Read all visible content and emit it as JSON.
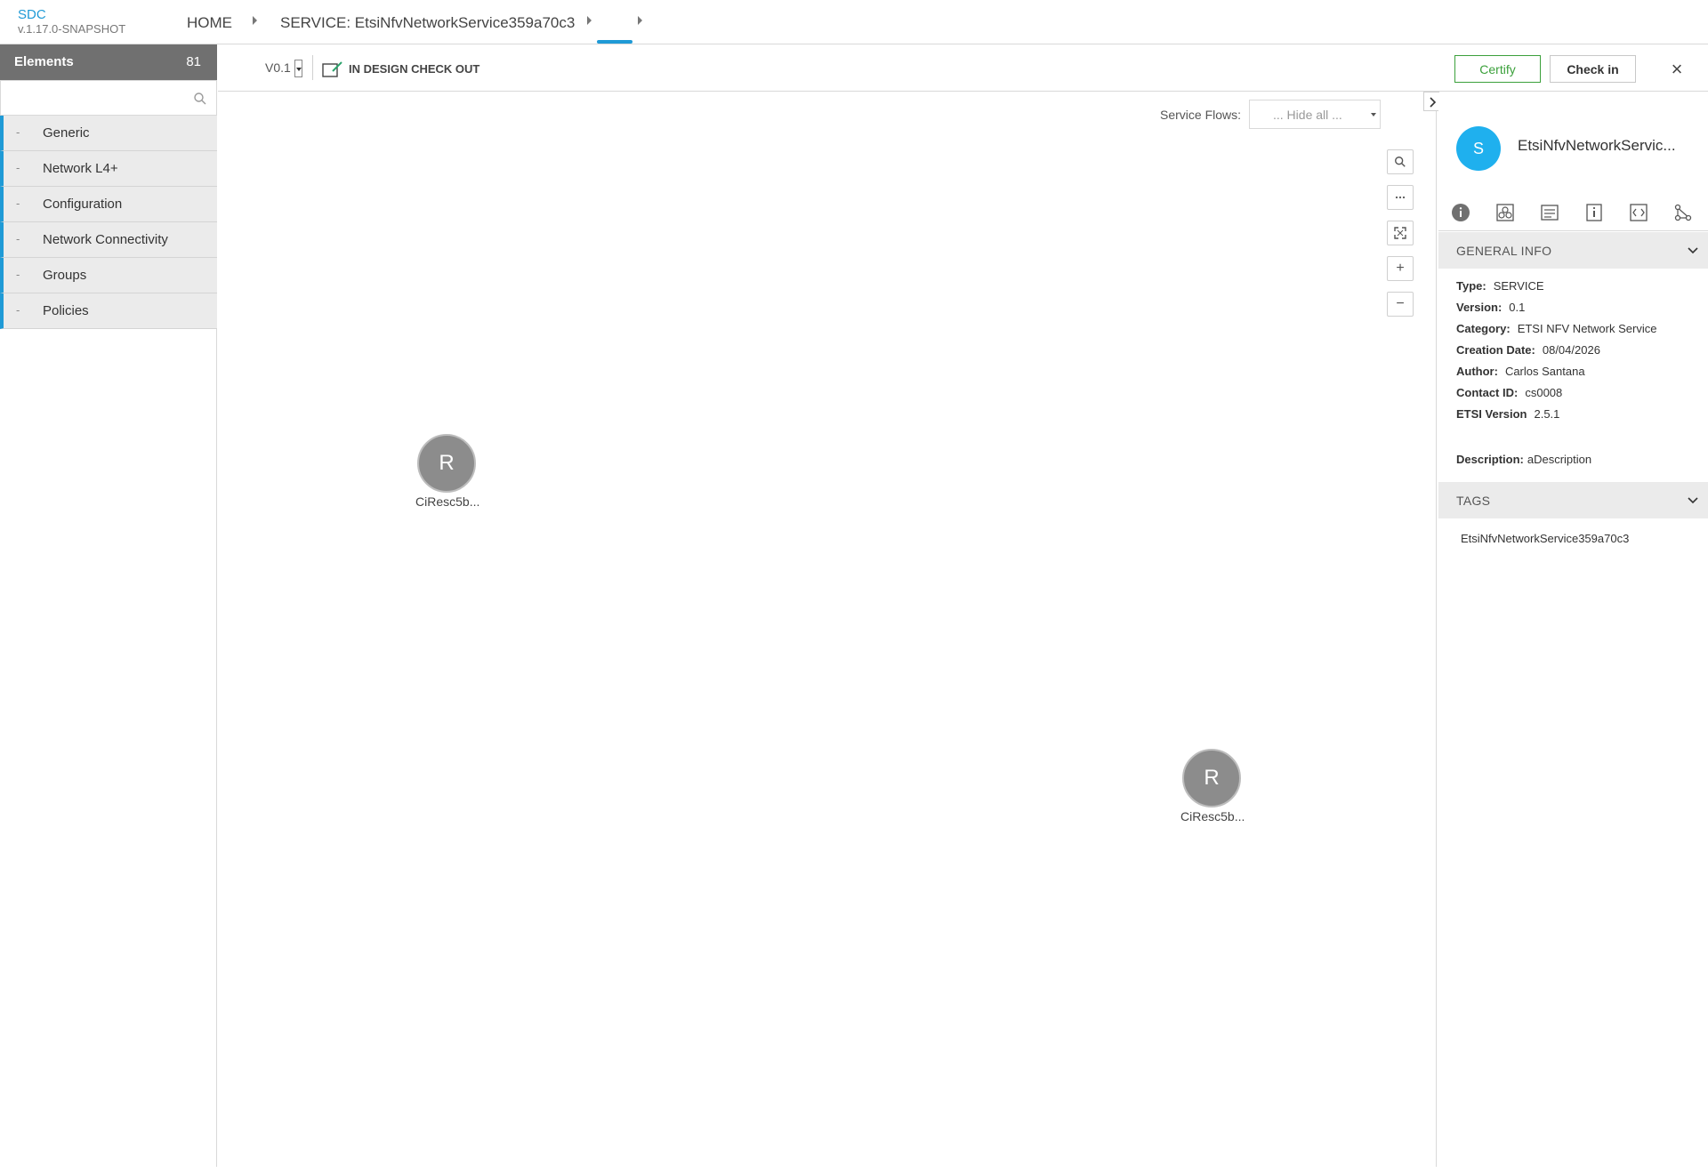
{
  "header": {
    "brand": "SDC",
    "version": "v.1.17.0-SNAPSHOT",
    "breadcrumbs": [
      "HOME",
      "SERVICE: EtsiNfvNetworkService359a70c3"
    ]
  },
  "left_panel": {
    "title": "Elements",
    "count": "81",
    "search_placeholder": "",
    "categories": [
      {
        "dash": "-",
        "label": "Generic"
      },
      {
        "dash": "-",
        "label": "Network L4+"
      },
      {
        "dash": "-",
        "label": "Configuration"
      },
      {
        "dash": "-",
        "label": "Network Connectivity"
      },
      {
        "dash": "-",
        "label": "Groups"
      },
      {
        "dash": "-",
        "label": "Policies"
      }
    ]
  },
  "toolbar": {
    "version": "V0.1",
    "status": "IN DESIGN CHECK OUT",
    "certify_label": "Certify",
    "checkin_label": "Check in",
    "close_label": "×"
  },
  "canvas": {
    "service_flows_label": "Service Flows:",
    "service_flows_value": "... Hide all ...",
    "zoom_buttons": [
      "search",
      "more",
      "fit",
      "+",
      "−"
    ],
    "nodes": [
      {
        "letter": "R",
        "label": "CiResc5b..."
      },
      {
        "letter": "R",
        "label": "CiResc5b..."
      }
    ]
  },
  "right_panel": {
    "avatar_letter": "S",
    "title": "EtsiNfvNetworkServic...",
    "general_info_title": "GENERAL INFO",
    "info": [
      {
        "key": "Type:",
        "value": "SERVICE"
      },
      {
        "key": "Version:",
        "value": "0.1"
      },
      {
        "key": "Category:",
        "value": "ETSI NFV Network Service"
      },
      {
        "key": "Creation Date:",
        "value": "08/04/2026"
      },
      {
        "key": "Author:",
        "value": "Carlos Santana"
      },
      {
        "key": "Contact ID:",
        "value": "cs0008"
      },
      {
        "key": "ETSI Version",
        "value": "2.5.1"
      }
    ],
    "description_key": "Description:",
    "description_value": "aDescription",
    "tags_title": "TAGS",
    "tags": [
      "EtsiNfvNetworkService359a70c3"
    ]
  },
  "colors": {
    "accent": "#1f9ad6",
    "certify": "#3ba03b",
    "avatar": "#1fb0ee",
    "node": "#8c8c8c"
  }
}
